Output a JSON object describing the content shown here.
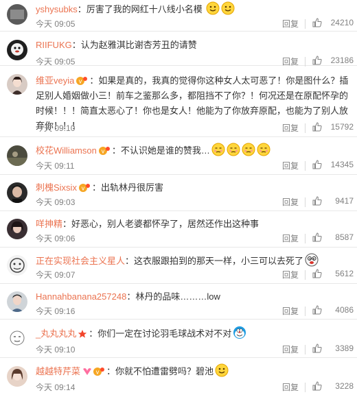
{
  "comments": [
    {
      "user": "yshysubks",
      "text": "厉害了我的网红十八线小名模",
      "time": "今天 09:05",
      "reply": "回复",
      "likes": "24210",
      "emojis": 2
    },
    {
      "user": "RIIFUKG",
      "text": "认为赵雅淇比谢杏芳丑的请赞",
      "time": "今天 09:05",
      "reply": "回复",
      "likes": "23186",
      "emojis": 0
    },
    {
      "user": "维亚veyia",
      "text": "如果是真的，我真的觉得你这种女人太可恶了！你是图什么？插足别人婚姻做小三！前车之鉴那么多，都阻挡不了你？！何况还是在原配怀孕的时候！！！简直太恶心了！你也是女人！他能为了你放弃原配，也能为了别人放弃你！！！",
      "time": "今天 09:10",
      "reply": "回复",
      "likes": "15792",
      "emojis": 0
    },
    {
      "user": "校花Williamson",
      "text": "不认识她是谁的赞我…",
      "time": "今天 09:11",
      "reply": "回复",
      "likes": "14345",
      "emojis": 4
    },
    {
      "user": "刺槐Sixsix",
      "text": "出轨林丹很厉害",
      "time": "今天 09:03",
      "reply": "回复",
      "likes": "9417",
      "emojis": 0
    },
    {
      "user": "咩抻精",
      "text": "好恶心，别人老婆都怀孕了，居然还作出这种事",
      "time": "今天 09:06",
      "reply": "回复",
      "likes": "8587",
      "emojis": 0
    },
    {
      "user": "正在实现社会主义星人",
      "text": "这衣服跟拍到的那天一样，小三可以去死了",
      "time": "今天 09:07",
      "reply": "回复",
      "likes": "5612",
      "emojis": 1
    },
    {
      "user": "Hannahbanana257248",
      "text": "林丹的品味………low",
      "time": "今天 09:16",
      "reply": "回复",
      "likes": "4086",
      "emojis": 0
    },
    {
      "user": "_丸丸丸丸",
      "text": "你们一定在讨论羽毛球战术对不对",
      "time": "今天 09:10",
      "reply": "回复",
      "likes": "3389",
      "emojis": 1
    },
    {
      "user": "越越特芹菜",
      "text": "你就不怕遭雷劈吗？碧池",
      "time": "今天 09:14",
      "reply": "回复",
      "likes": "3228",
      "emojis": 1
    }
  ],
  "colors": {
    "username": "#eb7350",
    "meta": "#808080",
    "text": "#333333",
    "divider": "#e8e8e8"
  },
  "icons": {
    "like": "thumbs-up-icon",
    "emoji": "smiley-face-icon",
    "badge": "verified-badge-icon"
  }
}
